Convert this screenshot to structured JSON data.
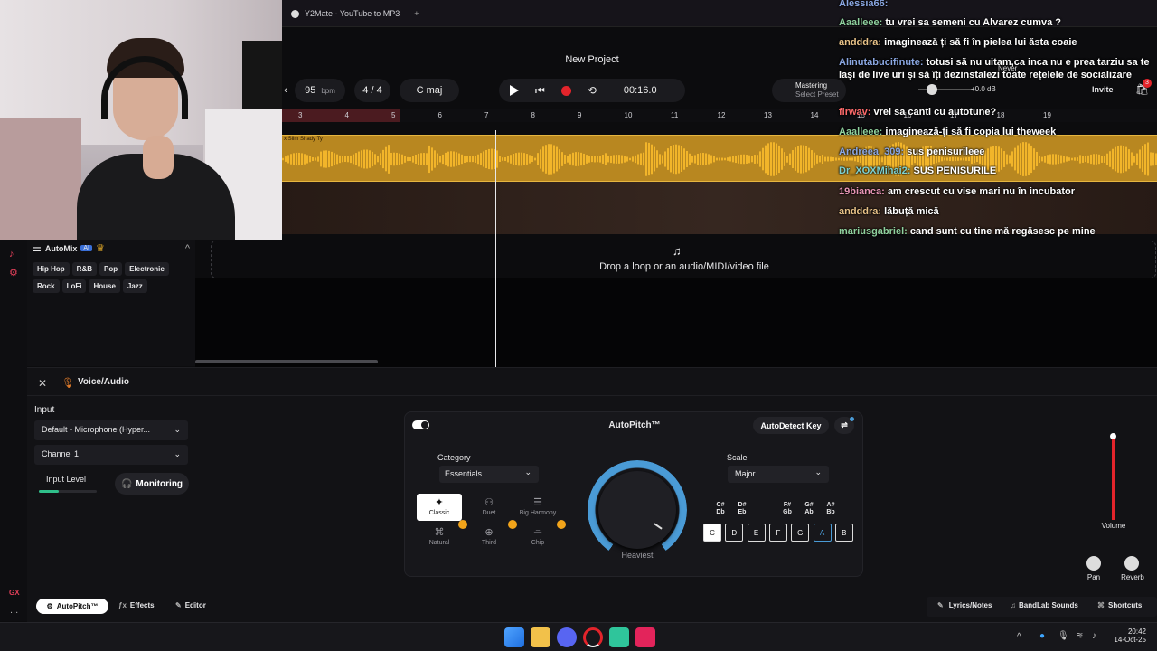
{
  "browser": {
    "tab_title": "Y2Mate - YouTube to MP3",
    "tab_close": "×",
    "new_tab": "+"
  },
  "project": {
    "title": "New Project"
  },
  "transport": {
    "bpm": "95",
    "bpm_unit": "bpm",
    "time_sig": "4 / 4",
    "key": "C maj",
    "time": "00:16.0",
    "mastering": "Mastering",
    "select_preset": "Select Preset",
    "never": "Never",
    "db": "+0.0 dB",
    "invite": "Invite",
    "badge": "3"
  },
  "ruler": [
    "3",
    "4",
    "5",
    "6",
    "7",
    "8",
    "9",
    "10",
    "11",
    "12",
    "13",
    "14",
    "15",
    "16",
    "17",
    "18",
    "19"
  ],
  "tracks": {
    "clip_name": "x Slim Shady Ty",
    "drop_text": "Drop a loop or an audio/MIDI/video file"
  },
  "automix": {
    "title": "AutoMix",
    "badge": "AI",
    "genres": [
      "Hip Hop",
      "R&B",
      "Pop",
      "Electronic",
      "Rock",
      "LoFi",
      "House",
      "Jazz"
    ]
  },
  "chat": [
    {
      "user": "Alessia66:",
      "text": "",
      "color": "u-blue"
    },
    {
      "user": "Aaalleee:",
      "text": "tu vrei sa semeni cu Alvarez cumva ?",
      "color": "u-green"
    },
    {
      "user": "andddra:",
      "text": "imaginează ți să fi în pielea lui ăsta coaie",
      "color": "u-tan"
    },
    {
      "user": "Alinutabucifinute:",
      "text": "totusi să nu uitam,ca inca nu e prea tarziu sa te lași de live uri și să îți dezinstalezi toate rețelele de socializare",
      "color": "u-blue"
    },
    {
      "user": "flrwav:",
      "text": "vrei sa canti cu autotune?",
      "color": "u-red"
    },
    {
      "user": "Aaalleee:",
      "text": "imaginează-ți să fi copia lui theweek",
      "color": "u-green"
    },
    {
      "user": "Andreea_309:",
      "text": "sus penisurileee",
      "color": "u-blue"
    },
    {
      "user": "Dr_XOXMihai2:",
      "text": "SUS PENISURILE",
      "color": "u-teal"
    },
    {
      "user": "19bianca:",
      "text": "am crescut cu vise mari nu în incubator",
      "color": "u-pink"
    },
    {
      "user": "andddra:",
      "text": "lăbuță mică",
      "color": "u-tan"
    },
    {
      "user": "mariusgabriel:",
      "text": "cand sunt cu tine mă regăsesc pe mine",
      "color": "u-green"
    }
  ],
  "panel": {
    "header": "Voice/Audio",
    "input_label": "Input",
    "input_device": "Default - Microphone (Hyper...",
    "channel": "Channel 1",
    "input_level": "Input Level",
    "input_level_value": 0.35,
    "monitoring": "Monitoring"
  },
  "autopitch": {
    "title": "AutoPitch™",
    "autodetect": "AutoDetect Key",
    "category_label": "Category",
    "category": "Essentials",
    "scale_label": "Scale",
    "scale": "Major",
    "knob_label": "Heaviest",
    "presets": [
      "Classic",
      "Duet",
      "Big Harmony",
      "Natural",
      "Third",
      "Chip"
    ],
    "sharps": [
      "C#\nDb",
      "D#\nEb",
      "F#\nGb",
      "G#\nAb",
      "A#\nBb"
    ],
    "keys": [
      "C",
      "D",
      "E",
      "F",
      "G",
      "A",
      "B"
    ]
  },
  "mixer": {
    "volume": "Volume",
    "pan": "Pan",
    "reverb": "Reverb"
  },
  "bottom": {
    "tab_autopitch": "AutoPitch™",
    "tab_effects": "Effects",
    "tab_editor": "Editor",
    "lyrics": "Lyrics/Notes",
    "sounds": "BandLab Sounds",
    "shortcuts": "Shortcuts"
  },
  "rail": {
    "gx": "GX",
    "dots": "..."
  },
  "taskbar": {
    "time": "20:42",
    "date": "14-Oct-25"
  },
  "colors": {
    "accent_blue": "#4a9bd6",
    "waveform": "#f2b52a",
    "record": "#e3242b"
  }
}
